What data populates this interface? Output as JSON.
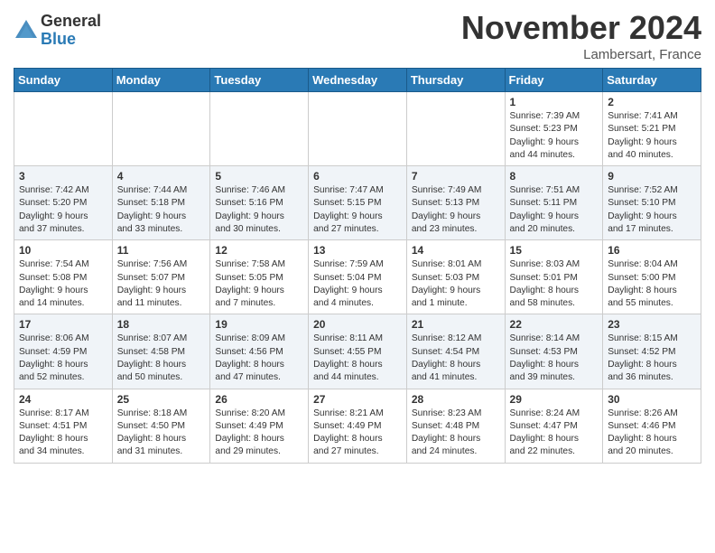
{
  "header": {
    "logo_line1": "General",
    "logo_line2": "Blue",
    "month_title": "November 2024",
    "location": "Lambersart, France"
  },
  "weekdays": [
    "Sunday",
    "Monday",
    "Tuesday",
    "Wednesday",
    "Thursday",
    "Friday",
    "Saturday"
  ],
  "weeks": [
    [
      {
        "day": "",
        "info": ""
      },
      {
        "day": "",
        "info": ""
      },
      {
        "day": "",
        "info": ""
      },
      {
        "day": "",
        "info": ""
      },
      {
        "day": "",
        "info": ""
      },
      {
        "day": "1",
        "info": "Sunrise: 7:39 AM\nSunset: 5:23 PM\nDaylight: 9 hours\nand 44 minutes."
      },
      {
        "day": "2",
        "info": "Sunrise: 7:41 AM\nSunset: 5:21 PM\nDaylight: 9 hours\nand 40 minutes."
      }
    ],
    [
      {
        "day": "3",
        "info": "Sunrise: 7:42 AM\nSunset: 5:20 PM\nDaylight: 9 hours\nand 37 minutes."
      },
      {
        "day": "4",
        "info": "Sunrise: 7:44 AM\nSunset: 5:18 PM\nDaylight: 9 hours\nand 33 minutes."
      },
      {
        "day": "5",
        "info": "Sunrise: 7:46 AM\nSunset: 5:16 PM\nDaylight: 9 hours\nand 30 minutes."
      },
      {
        "day": "6",
        "info": "Sunrise: 7:47 AM\nSunset: 5:15 PM\nDaylight: 9 hours\nand 27 minutes."
      },
      {
        "day": "7",
        "info": "Sunrise: 7:49 AM\nSunset: 5:13 PM\nDaylight: 9 hours\nand 23 minutes."
      },
      {
        "day": "8",
        "info": "Sunrise: 7:51 AM\nSunset: 5:11 PM\nDaylight: 9 hours\nand 20 minutes."
      },
      {
        "day": "9",
        "info": "Sunrise: 7:52 AM\nSunset: 5:10 PM\nDaylight: 9 hours\nand 17 minutes."
      }
    ],
    [
      {
        "day": "10",
        "info": "Sunrise: 7:54 AM\nSunset: 5:08 PM\nDaylight: 9 hours\nand 14 minutes."
      },
      {
        "day": "11",
        "info": "Sunrise: 7:56 AM\nSunset: 5:07 PM\nDaylight: 9 hours\nand 11 minutes."
      },
      {
        "day": "12",
        "info": "Sunrise: 7:58 AM\nSunset: 5:05 PM\nDaylight: 9 hours\nand 7 minutes."
      },
      {
        "day": "13",
        "info": "Sunrise: 7:59 AM\nSunset: 5:04 PM\nDaylight: 9 hours\nand 4 minutes."
      },
      {
        "day": "14",
        "info": "Sunrise: 8:01 AM\nSunset: 5:03 PM\nDaylight: 9 hours\nand 1 minute."
      },
      {
        "day": "15",
        "info": "Sunrise: 8:03 AM\nSunset: 5:01 PM\nDaylight: 8 hours\nand 58 minutes."
      },
      {
        "day": "16",
        "info": "Sunrise: 8:04 AM\nSunset: 5:00 PM\nDaylight: 8 hours\nand 55 minutes."
      }
    ],
    [
      {
        "day": "17",
        "info": "Sunrise: 8:06 AM\nSunset: 4:59 PM\nDaylight: 8 hours\nand 52 minutes."
      },
      {
        "day": "18",
        "info": "Sunrise: 8:07 AM\nSunset: 4:58 PM\nDaylight: 8 hours\nand 50 minutes."
      },
      {
        "day": "19",
        "info": "Sunrise: 8:09 AM\nSunset: 4:56 PM\nDaylight: 8 hours\nand 47 minutes."
      },
      {
        "day": "20",
        "info": "Sunrise: 8:11 AM\nSunset: 4:55 PM\nDaylight: 8 hours\nand 44 minutes."
      },
      {
        "day": "21",
        "info": "Sunrise: 8:12 AM\nSunset: 4:54 PM\nDaylight: 8 hours\nand 41 minutes."
      },
      {
        "day": "22",
        "info": "Sunrise: 8:14 AM\nSunset: 4:53 PM\nDaylight: 8 hours\nand 39 minutes."
      },
      {
        "day": "23",
        "info": "Sunrise: 8:15 AM\nSunset: 4:52 PM\nDaylight: 8 hours\nand 36 minutes."
      }
    ],
    [
      {
        "day": "24",
        "info": "Sunrise: 8:17 AM\nSunset: 4:51 PM\nDaylight: 8 hours\nand 34 minutes."
      },
      {
        "day": "25",
        "info": "Sunrise: 8:18 AM\nSunset: 4:50 PM\nDaylight: 8 hours\nand 31 minutes."
      },
      {
        "day": "26",
        "info": "Sunrise: 8:20 AM\nSunset: 4:49 PM\nDaylight: 8 hours\nand 29 minutes."
      },
      {
        "day": "27",
        "info": "Sunrise: 8:21 AM\nSunset: 4:49 PM\nDaylight: 8 hours\nand 27 minutes."
      },
      {
        "day": "28",
        "info": "Sunrise: 8:23 AM\nSunset: 4:48 PM\nDaylight: 8 hours\nand 24 minutes."
      },
      {
        "day": "29",
        "info": "Sunrise: 8:24 AM\nSunset: 4:47 PM\nDaylight: 8 hours\nand 22 minutes."
      },
      {
        "day": "30",
        "info": "Sunrise: 8:26 AM\nSunset: 4:46 PM\nDaylight: 8 hours\nand 20 minutes."
      }
    ]
  ]
}
